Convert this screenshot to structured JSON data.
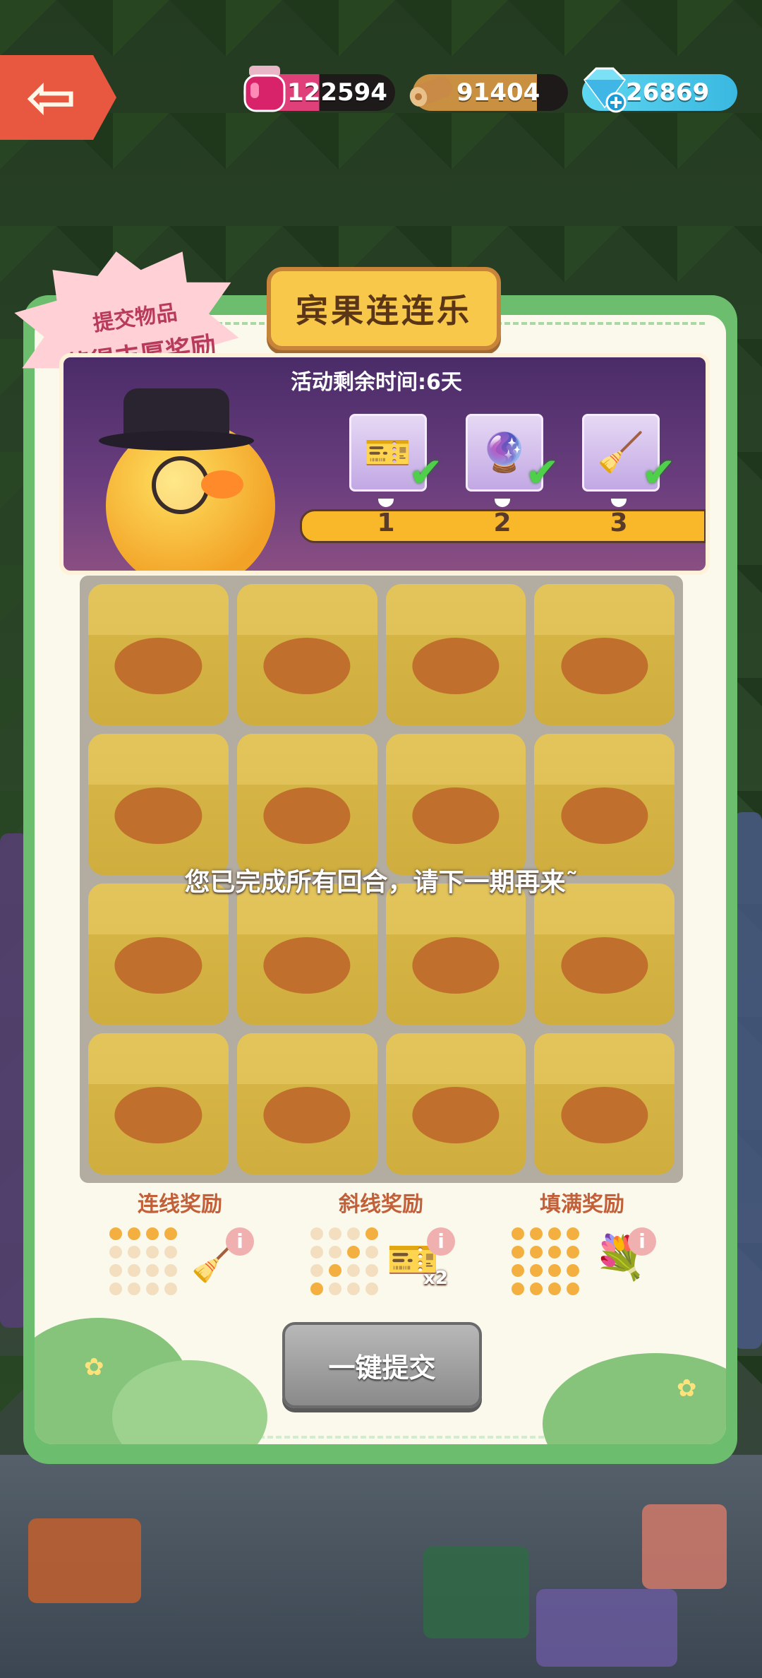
{
  "resources": {
    "ink": "122594",
    "wood": "91404",
    "diamond": "26869"
  },
  "panel": {
    "title": "宾果连连乐",
    "promo_line1": "提交物品",
    "promo_line2": "获得丰厚奖励"
  },
  "banner": {
    "time_remaining": "活动剩余时间:6天",
    "milestones": [
      {
        "num": "1",
        "reward": "ticket-icon",
        "claimed": true
      },
      {
        "num": "2",
        "reward": "crystal-ball-icon",
        "claimed": true
      },
      {
        "num": "3",
        "reward": "broom-icon",
        "claimed": true
      }
    ]
  },
  "grid": {
    "message": "您已完成所有回合，请下一期再来˜"
  },
  "rewards": {
    "line_label": "连线奖励",
    "diagonal_label": "斜线奖励",
    "diagonal_multiplier": "x2",
    "fill_label": "填满奖励"
  },
  "submit": {
    "label": "一键提交"
  },
  "colors": {
    "accent_green": "#6cbe6e",
    "title_yellow": "#f8c84a",
    "back_red": "#e8573f",
    "disabled_gray": "#9a9a9a"
  }
}
